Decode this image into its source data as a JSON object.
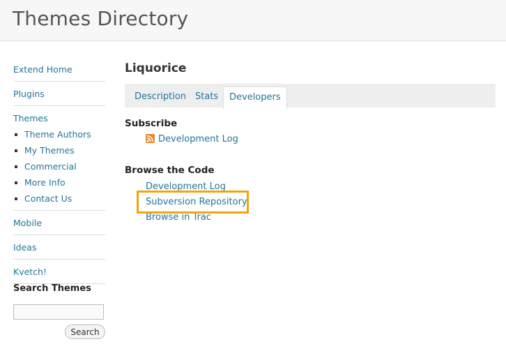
{
  "header": {
    "title": "Themes Directory"
  },
  "sidebar": {
    "items": [
      {
        "label": "Extend Home"
      },
      {
        "label": "Plugins"
      },
      {
        "label": "Themes"
      }
    ],
    "theme_subitems": [
      {
        "label": "Theme Authors"
      },
      {
        "label": "My Themes"
      },
      {
        "label": "Commercial"
      },
      {
        "label": "More Info"
      },
      {
        "label": "Contact Us"
      }
    ],
    "more_items": [
      {
        "label": "Mobile"
      },
      {
        "label": "Ideas"
      },
      {
        "label": "Kvetch!"
      }
    ],
    "search": {
      "title": "Search Themes",
      "placeholder": "",
      "button_label": "Search"
    }
  },
  "main": {
    "title": "Liquorice",
    "tabs": [
      {
        "label": "Description"
      },
      {
        "label": "Stats"
      },
      {
        "label": "Developers",
        "active": true
      }
    ],
    "subscribe": {
      "title": "Subscribe",
      "feed_link": "Development Log",
      "icon": "rss-icon"
    },
    "browse": {
      "title": "Browse the Code",
      "links": [
        {
          "label": "Development Log"
        },
        {
          "label": "Subversion Repository",
          "highlighted": true
        },
        {
          "label": "Browse in Trac"
        }
      ]
    }
  },
  "colors": {
    "link": "#21759b",
    "highlight": "#f4a30a",
    "rss": "#e8862a"
  }
}
